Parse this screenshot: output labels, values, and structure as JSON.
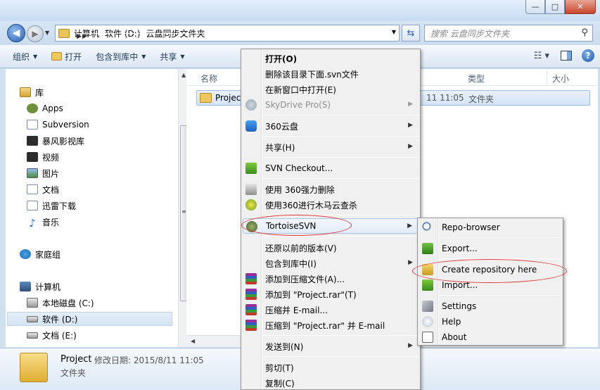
{
  "window": {
    "minimize_glyph": "—",
    "maximize_glyph": "□",
    "close_glyph": "✕"
  },
  "address": {
    "crumbs": [
      "计算机",
      "软件 (D:)",
      "云盘同步文件夹"
    ],
    "search_placeholder": "搜索 云盘同步文件夹"
  },
  "toolbar": {
    "organize": "组织",
    "open": "打开",
    "include_library": "包含到库中",
    "share": "共享"
  },
  "nav": {
    "items": [
      {
        "label": "库",
        "icon": "library-icon"
      },
      {
        "label": "Apps",
        "icon": "apps-icon"
      },
      {
        "label": "Subversion",
        "icon": "document-icon"
      },
      {
        "label": "暴风影视库",
        "icon": "video-library-icon"
      },
      {
        "label": "视频",
        "icon": "video-icon"
      },
      {
        "label": "图片",
        "icon": "pictures-icon"
      },
      {
        "label": "文档",
        "icon": "documents-icon"
      },
      {
        "label": "迅雷下载",
        "icon": "download-icon"
      },
      {
        "label": "音乐",
        "icon": "music-icon"
      },
      {
        "label": "家庭组",
        "icon": "homegroup-icon"
      },
      {
        "label": "计算机",
        "icon": "computer-icon"
      },
      {
        "label": "本地磁盘 (C:)",
        "icon": "drive-c-icon"
      },
      {
        "label": "软件 (D:)",
        "icon": "drive-d-icon"
      },
      {
        "label": "文档 (E:)",
        "icon": "drive-e-icon"
      }
    ]
  },
  "content": {
    "columns": {
      "name": "名称",
      "type": "类型",
      "size": "大小"
    },
    "files": [
      {
        "name": "Project",
        "date": "11 11:05",
        "type": "文件夹"
      }
    ]
  },
  "details": {
    "name": "Project",
    "modified": "修改日期: 2015/8/11 11:05",
    "type": "文件夹"
  },
  "context_menu": {
    "items": [
      {
        "label": "打开(O)"
      },
      {
        "label": "删除该目录下面.svn文件"
      },
      {
        "label": "在新窗口中打开(E)"
      },
      {
        "label": "SkyDrive Pro(S)"
      },
      {
        "label": "360云盘"
      },
      {
        "label": "共享(H)"
      },
      {
        "label": "SVN Checkout..."
      },
      {
        "label": "使用 360强力删除"
      },
      {
        "label": "使用360进行木马云查杀"
      },
      {
        "label": "TortoiseSVN"
      },
      {
        "label": "还原以前的版本(V)"
      },
      {
        "label": "包含到库中(I)"
      },
      {
        "label": "添加到压缩文件(A)..."
      },
      {
        "label": "添加到 \"Project.rar\"(T)"
      },
      {
        "label": "压缩并 E-mail..."
      },
      {
        "label": "压缩到 \"Project.rar\" 并 E-mail"
      },
      {
        "label": "发送到(N)"
      },
      {
        "label": "剪切(T)"
      },
      {
        "label": "复制(C)"
      }
    ]
  },
  "submenu": {
    "items": [
      {
        "label": "Repo-browser"
      },
      {
        "label": "Export..."
      },
      {
        "label": "Create repository here"
      },
      {
        "label": "Import..."
      },
      {
        "label": "Settings"
      },
      {
        "label": "Help"
      },
      {
        "label": "About"
      }
    ]
  },
  "colors": {
    "annotation": "#e03a3a",
    "highlight_border": "#a9c3e4"
  }
}
